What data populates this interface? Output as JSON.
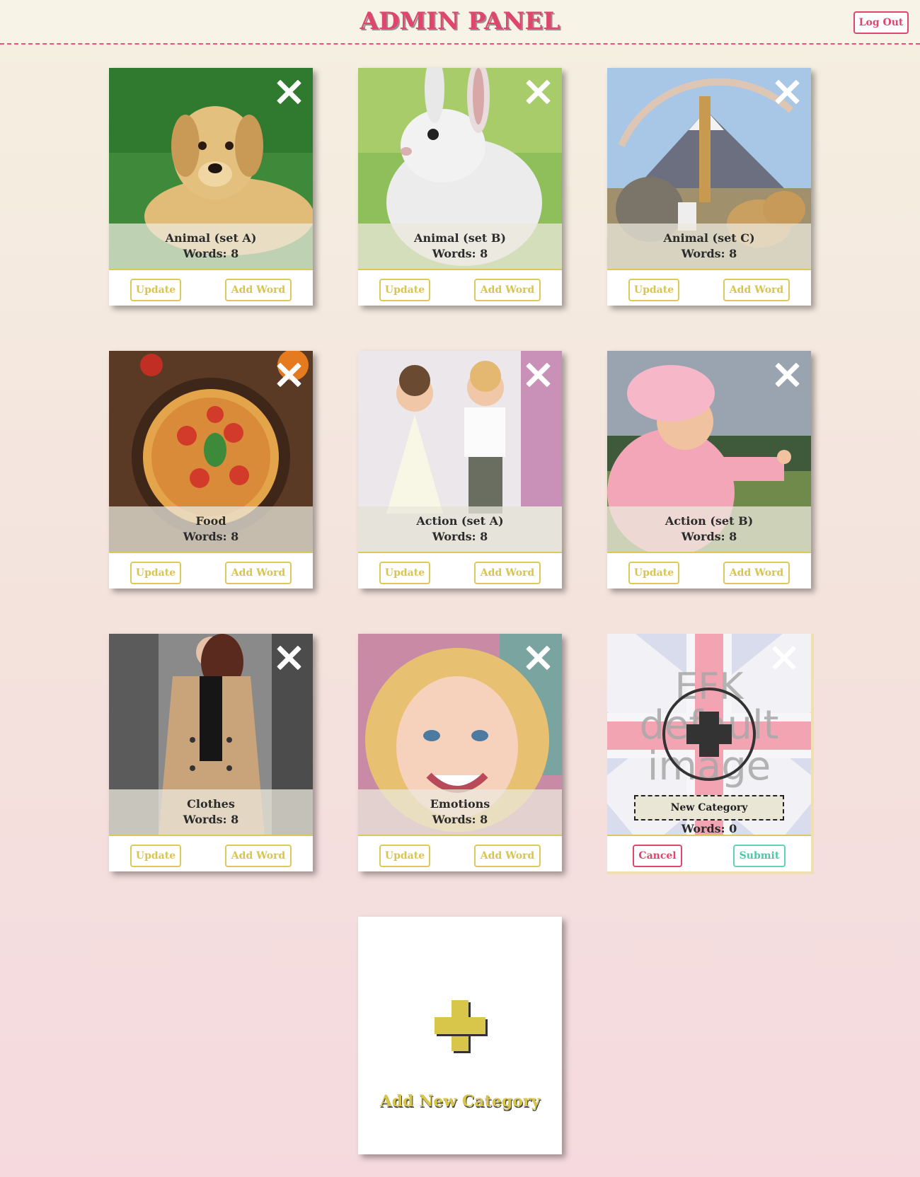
{
  "header": {
    "title": "ADMIN PANEL",
    "logout_label": "Log Out"
  },
  "card_buttons": {
    "update": "Update",
    "add_word": "Add Word"
  },
  "categories": [
    {
      "name": "Animal (set A)",
      "words": "Words: 8",
      "image": "puppy-photo"
    },
    {
      "name": "Animal (set B)",
      "words": "Words: 8",
      "image": "rabbit-photo"
    },
    {
      "name": "Animal (set C)",
      "words": "Words: 8",
      "image": "wildlife-photo"
    },
    {
      "name": "Food",
      "words": "Words: 8",
      "image": "pizza-photo"
    },
    {
      "name": "Action (set A)",
      "words": "Words: 8",
      "image": "dancing-kids-photo"
    },
    {
      "name": "Action (set B)",
      "words": "Words: 8",
      "image": "pointing-child-photo"
    },
    {
      "name": "Clothes",
      "words": "Words: 8",
      "image": "coat-photo"
    },
    {
      "name": "Emotions",
      "words": "Words: 8",
      "image": "smiling-girl-photo"
    }
  ],
  "new_category": {
    "input_value": "New Category",
    "words": "Words: 0",
    "cancel_label": "Cancel",
    "submit_label": "Submit",
    "default_image_text": [
      "EFK",
      "default",
      "image"
    ]
  },
  "add_category": {
    "label": "Add New Category"
  },
  "colors": {
    "accent_pink": "#e0456e",
    "accent_gold": "#d8c64a",
    "accent_teal": "#49c9a9"
  }
}
